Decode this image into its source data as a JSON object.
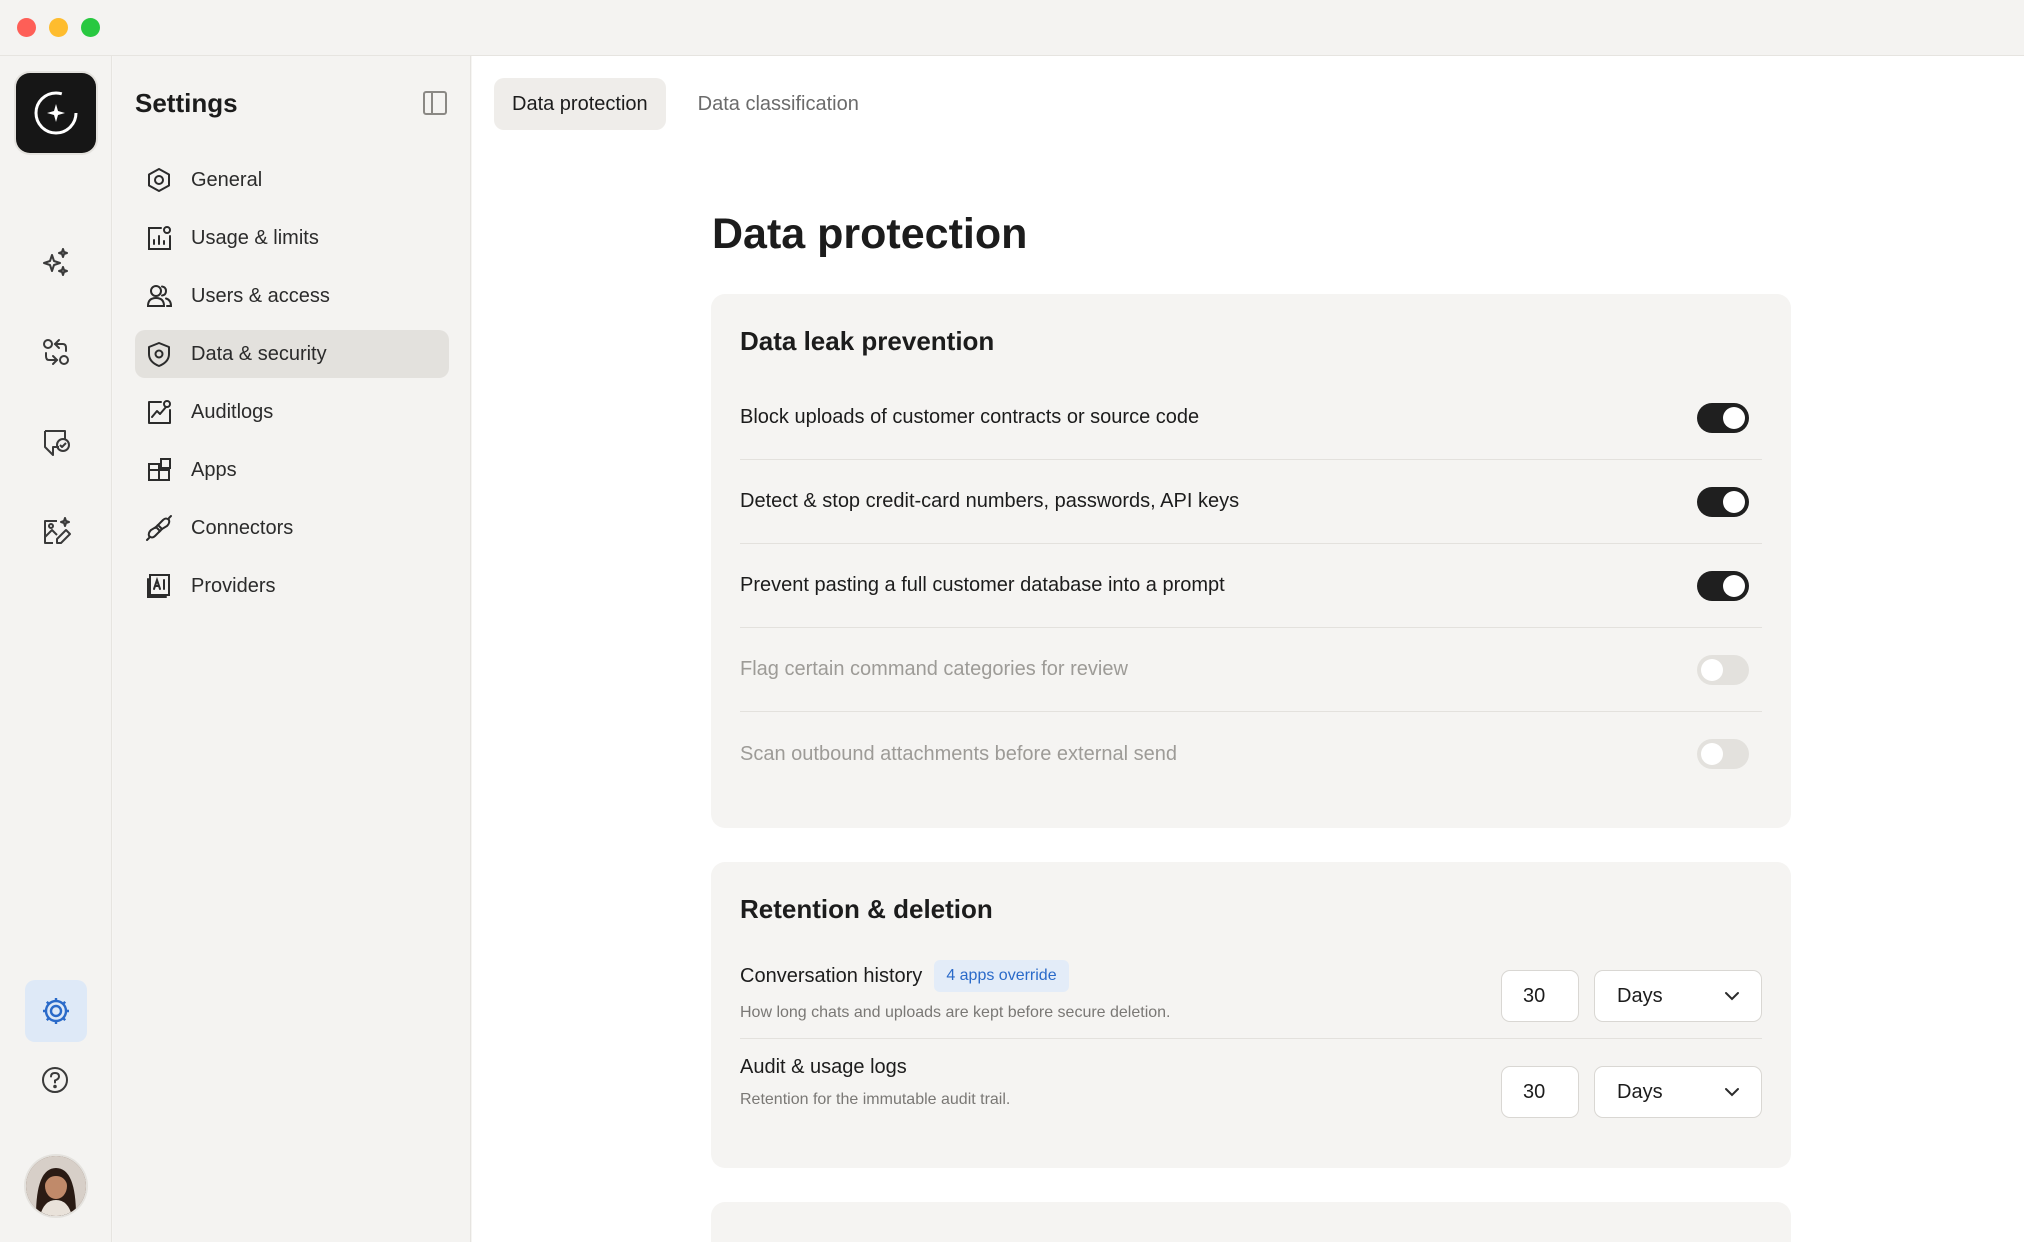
{
  "window": {
    "title": "Settings"
  },
  "sidebar": {
    "title": "Settings",
    "items": [
      {
        "label": "General",
        "icon": "hexagon-gear-icon"
      },
      {
        "label": "Usage & limits",
        "icon": "chart-icon"
      },
      {
        "label": "Users & access",
        "icon": "users-icon"
      },
      {
        "label": "Data & security",
        "icon": "shield-icon",
        "active": true
      },
      {
        "label": "Auditlogs",
        "icon": "line-chart-icon"
      },
      {
        "label": "Apps",
        "icon": "apps-grid-icon"
      },
      {
        "label": "Connectors",
        "icon": "plug-icon"
      },
      {
        "label": "Providers",
        "icon": "ai-box-icon"
      }
    ]
  },
  "tabs": [
    {
      "label": "Data protection",
      "active": true
    },
    {
      "label": "Data classification",
      "active": false
    }
  ],
  "page": {
    "title": "Data protection"
  },
  "leak_prevention": {
    "title": "Data leak prevention",
    "rules": [
      {
        "label": "Block uploads of customer contracts or source code",
        "enabled": true
      },
      {
        "label": "Detect & stop credit-card numbers, passwords, API keys",
        "enabled": true
      },
      {
        "label": "Prevent pasting a full customer database into a prompt",
        "enabled": true
      },
      {
        "label": "Flag certain command categories for review",
        "enabled": false
      },
      {
        "label": "Scan outbound attachments before external send",
        "enabled": false
      }
    ]
  },
  "retention": {
    "title": "Retention & deletion",
    "conversation": {
      "label": "Conversation history",
      "badge": "4 apps override",
      "description": "How long chats and uploads are kept before secure deletion.",
      "value": "30",
      "unit": "Days"
    },
    "audit": {
      "label": "Audit & usage logs",
      "description": "Retention for the immutable audit trail.",
      "value": "30",
      "unit": "Days"
    }
  },
  "colors": {
    "accent": "#2a6ac9",
    "toggle_on": "#1f1f1f",
    "card_bg": "#f5f4f2"
  }
}
